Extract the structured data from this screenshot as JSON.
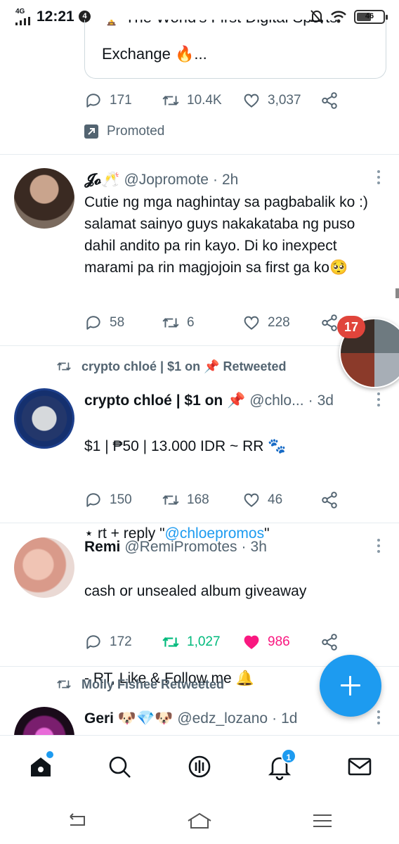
{
  "status_bar": {
    "network": "4G",
    "time": "12:21",
    "notification_count": "4",
    "battery": "46"
  },
  "promo_card": {
    "cut_line": "🏆 The World's First Digital Sports",
    "text": "Exchange 🔥..."
  },
  "promo_tweet": {
    "replies": "171",
    "retweets": "10.4K",
    "likes": "3,037",
    "promoted_label": "Promoted"
  },
  "tweets": [
    {
      "name": "𝓙𝓸🥂",
      "handle": "@Jopromote",
      "time": "2h",
      "text": "Cutie ng mga naghintay sa pagbabalik ko :) salamat sainyo guys nakakataba ng puso dahil andito pa rin kayo. Di ko inexpect marami pa rin magjojoin sa first ga ko🥺",
      "replies": "58",
      "retweets": "6",
      "likes": "228"
    },
    {
      "retweeted_by": "crypto chloé | $1 on 📌 Retweeted",
      "name": "crypto chloé | $1 on 📌",
      "handle": "@chlo...",
      "time": "3d",
      "text_line1": "$1 | ₱50 | 13.000 IDR ~ RR 🐾",
      "text_line2_prefix": "⋆ rt + reply \"",
      "text_line2_link": "@chloepromos",
      "text_line2_suffix": "\"",
      "replies": "150",
      "retweets": "168",
      "likes": "46"
    },
    {
      "name": "Remi",
      "handle": "@RemiPromotes",
      "time": "3h",
      "text_line1": "cash or unsealed album giveaway",
      "text_line2": "- RT, Like & Follow me 🔔",
      "replies": "172",
      "retweets": "1,027",
      "likes": "986"
    },
    {
      "retweeted_by": "Molly Fishee Retweeted",
      "name": "Geri 🐶💎🐶",
      "handle": "@edz_lozano",
      "time": "1d"
    }
  ],
  "chat_bubble": {
    "badge": "17"
  },
  "bottom_nav": {
    "notifications_badge": "1"
  },
  "colors": {
    "accent": "#1d9bf0",
    "retweet_active": "#00ba7c",
    "like_active": "#f91880"
  }
}
